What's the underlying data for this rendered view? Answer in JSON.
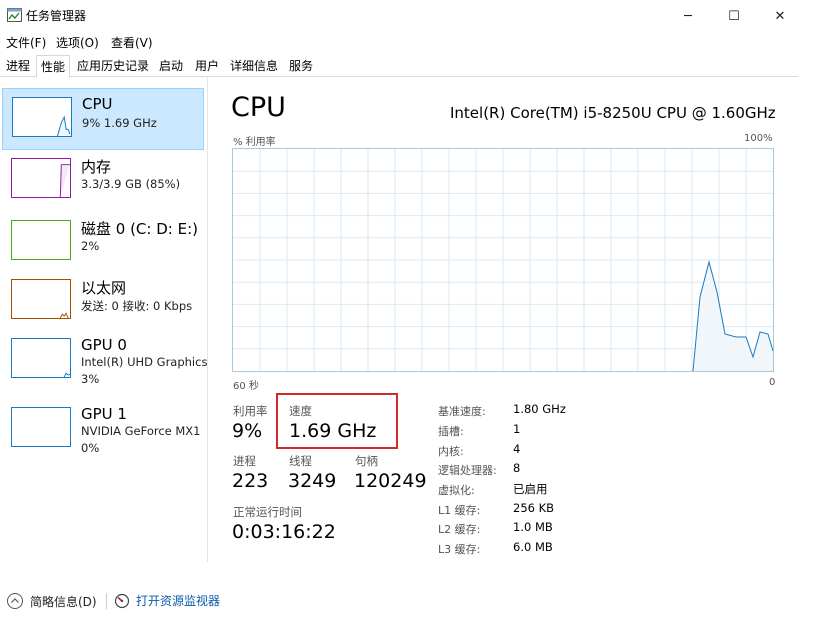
{
  "window": {
    "title": "任务管理器",
    "minimize_glyph": "─",
    "maximize_glyph": "☐",
    "close_glyph": "✕"
  },
  "menu": [
    "文件(F)",
    "选项(O)",
    "查看(V)"
  ],
  "tabs": [
    {
      "label": "进程",
      "selected": false
    },
    {
      "label": "性能",
      "selected": true
    },
    {
      "label": "应用历史记录",
      "selected": false
    },
    {
      "label": "启动",
      "selected": false
    },
    {
      "label": "用户",
      "selected": false
    },
    {
      "label": "详细信息",
      "selected": false
    },
    {
      "label": "服务",
      "selected": false
    }
  ],
  "sidebar": {
    "items": [
      {
        "title": "CPU",
        "sub1": "9% 1.69 GHz",
        "sub2": "",
        "color": "#1a7ac2",
        "selected": true
      },
      {
        "title": "内存",
        "sub1": "3.3/3.9 GB (85%)",
        "sub2": "",
        "color": "#8b1c9e",
        "selected": false
      },
      {
        "title": "磁盘 0 (C: D: E:)",
        "sub1": "2%",
        "sub2": "",
        "color": "#4da60c",
        "selected": false
      },
      {
        "title": "以太网",
        "sub1": "发送: 0 接收: 0 Kbps",
        "sub2": "",
        "color": "#a74f01",
        "selected": false
      },
      {
        "title": "GPU 0",
        "sub1": "Intel(R) UHD Graphics",
        "sub2": "3%",
        "color": "#1a7ac2",
        "selected": false
      },
      {
        "title": "GPU 1",
        "sub1": "NVIDIA GeForce MX1",
        "sub2": "0%",
        "color": "#1a7ac2",
        "selected": false
      }
    ]
  },
  "main": {
    "title": "CPU",
    "model": "Intel(R) Core(TM) i5-8250U CPU @ 1.60GHz",
    "graph": {
      "y_label": "% 利用率",
      "y_max_label": "100%",
      "x_left_label": "60 秒",
      "x_right_label": "0",
      "line_color": "#1a7ac2",
      "fill_color": "#f1f6fa",
      "grid_color": "#d9eaf4"
    },
    "stats": {
      "util_label": "利用率",
      "util_value": "9%",
      "speed_label": "速度",
      "speed_value": "1.69 GHz",
      "proc_label": "进程",
      "proc_value": "223",
      "thread_label": "线程",
      "thread_value": "3249",
      "handle_label": "句柄",
      "handle_value": "120249",
      "uptime_label": "正常运行时间",
      "uptime_value": "0:03:16:22"
    },
    "specs": [
      {
        "key": "基准速度:",
        "value": "1.80 GHz"
      },
      {
        "key": "插槽:",
        "value": "1"
      },
      {
        "key": "内核:",
        "value": "4"
      },
      {
        "key": "逻辑处理器:",
        "value": "8"
      },
      {
        "key": "虚拟化:",
        "value": "已启用"
      },
      {
        "key": "L1 缓存:",
        "value": "256 KB"
      },
      {
        "key": "L2 缓存:",
        "value": "1.0 MB"
      },
      {
        "key": "L3 缓存:",
        "value": "6.0 MB"
      }
    ]
  },
  "bottom": {
    "fewer_details": "简略信息(D)",
    "open_monitor": "打开资源监视器"
  }
}
